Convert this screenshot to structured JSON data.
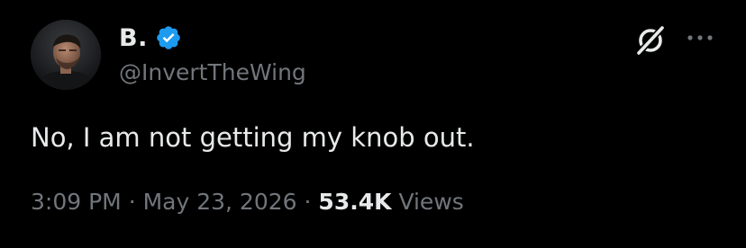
{
  "author": {
    "display_name": "B.",
    "handle": "@InvertTheWing",
    "verified": true
  },
  "tweet": {
    "text": "No, I am not getting my knob out."
  },
  "meta": {
    "time": "3:09 PM",
    "separator": "·",
    "date": "May 23, 2026",
    "views_count": "53.4K",
    "views_label": "Views"
  },
  "icons": {
    "verified": "verified-badge-icon",
    "grok": "grok-icon",
    "more": "more-options-icon"
  },
  "colors": {
    "background": "#000000",
    "primary_text": "#e7e9ea",
    "secondary_text": "#71767b",
    "verified_blue": "#1d9bf0"
  }
}
